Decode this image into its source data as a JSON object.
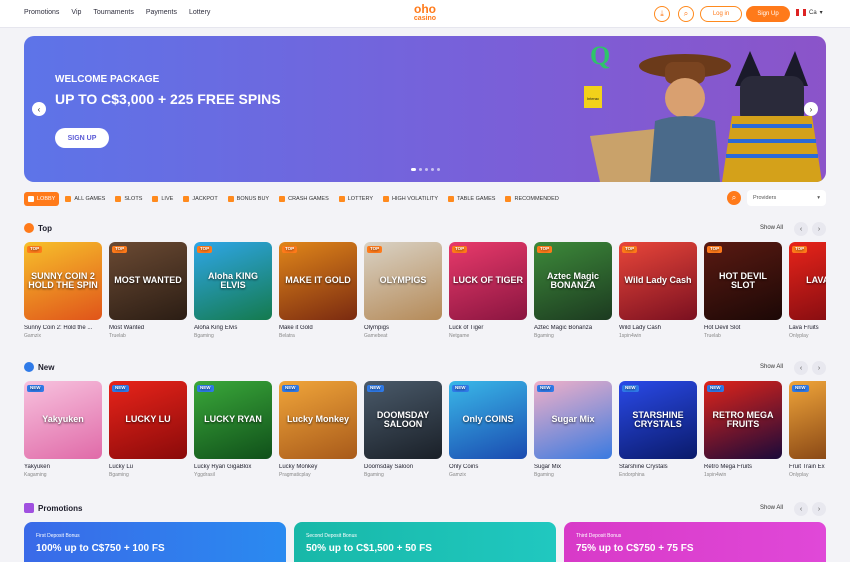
{
  "header": {
    "nav": [
      "Promotions",
      "Vip",
      "Tournaments",
      "Payments",
      "Lottery"
    ],
    "logo_top": "oho",
    "logo_bottom": "casino",
    "login_label": "Log in",
    "signup_label": "Sign Up",
    "lang_label": "Ca"
  },
  "hero": {
    "eyebrow": "WELCOME PACKAGE",
    "headline": "UP TO C$3,000 + 225 FREE SPINS",
    "cta": "SIGN UP",
    "prev": "‹",
    "next": "›",
    "payment_badge": "Interac"
  },
  "tabs": [
    "LOBBY",
    "ALL GAMES",
    "SLOTS",
    "LIVE",
    "JACKPOT",
    "BONUS BUY",
    "CRASH GAMES",
    "LOTTERY",
    "HIGH VOLATILITY",
    "TABLE GAMES",
    "RECOMMENDED"
  ],
  "providers_placeholder": "Providers",
  "colors": {
    "accent": "#ff7a1a",
    "hero_start": "#5d74e8",
    "hero_end": "#8b54c9"
  },
  "top": {
    "title": "Top",
    "show_all": "Show All",
    "badge": "TOP",
    "games": [
      {
        "name": "Sunny Coin 2: Hold the ...",
        "provider": "Gamzix",
        "art": "SUNNY COIN 2 HOLD THE SPIN",
        "bg": "linear-gradient(160deg,#f7c02b,#e0541a)"
      },
      {
        "name": "Most Wanted",
        "provider": "Truelab",
        "art": "MOST WANTED",
        "bg": "linear-gradient(160deg,#6b4a33,#2b1d14)"
      },
      {
        "name": "Aloha King Elvis",
        "provider": "Bgaming",
        "art": "Aloha KING ELVIS",
        "bg": "linear-gradient(160deg,#2fa6e8,#147a4d)"
      },
      {
        "name": "Make it Gold",
        "provider": "Belatra",
        "art": "MAKE IT GOLD",
        "bg": "linear-gradient(160deg,#e0861a,#7a2a10)"
      },
      {
        "name": "Olympigs",
        "provider": "Gamebeat",
        "art": "OLYMPIGS",
        "bg": "linear-gradient(160deg,#d9d2c5,#b58a58)"
      },
      {
        "name": "Luck of Tiger",
        "provider": "Netgame",
        "art": "LUCK OF TIGER",
        "bg": "linear-gradient(160deg,#e83a6b,#8a1540)"
      },
      {
        "name": "Aztec Magic Bonanza",
        "provider": "Bgaming",
        "art": "Aztec Magic BONANZA",
        "bg": "linear-gradient(160deg,#3d8a3a,#1c3a20)"
      },
      {
        "name": "Wild Lady Cash",
        "provider": "1spin4win",
        "art": "Wild Lady Cash",
        "bg": "linear-gradient(160deg,#e8463a,#7a1020)"
      },
      {
        "name": "Hot Devil Slot",
        "provider": "Truelab",
        "art": "HOT DEVIL SLOT",
        "bg": "linear-gradient(160deg,#5a1a12,#1c0806)"
      },
      {
        "name": "Lava Fruits",
        "provider": "Onlyplay",
        "art": "LAVA FRU",
        "bg": "linear-gradient(160deg,#e8241a,#7a0a10)"
      }
    ]
  },
  "new": {
    "title": "New",
    "show_all": "Show All",
    "badge": "NEW",
    "games": [
      {
        "name": "Yakyuken",
        "provider": "Kagaming",
        "art": "Yakyuken",
        "bg": "linear-gradient(160deg,#f7c2de,#e06aa8)"
      },
      {
        "name": "Lucky Lu",
        "provider": "Bgaming",
        "art": "LUCKY LU",
        "bg": "linear-gradient(160deg,#e8241a,#8a0a0a)"
      },
      {
        "name": "Lucky Ryan GigaBlox",
        "provider": "Yggdrasil",
        "art": "LUCKY RYAN",
        "bg": "linear-gradient(160deg,#3aa83a,#10501a)"
      },
      {
        "name": "Lucky Monkey",
        "provider": "Pragmaticplay",
        "art": "Lucky Monkey",
        "bg": "linear-gradient(160deg,#f0a53a,#a85a1a)"
      },
      {
        "name": "Doomsday Saloon",
        "provider": "Bgaming",
        "art": "DOOMSDAY SALOON",
        "bg": "linear-gradient(160deg,#4a5a6a,#1a2028)"
      },
      {
        "name": "Only Coins",
        "provider": "Gamzix",
        "art": "Only COINS",
        "bg": "linear-gradient(160deg,#3ab8e8,#1a4ab0)"
      },
      {
        "name": "Sugar Mix",
        "provider": "Bgaming",
        "art": "Sugar Mix",
        "bg": "linear-gradient(160deg,#f0b0c8,#3a7ae0)"
      },
      {
        "name": "Starshine Crystals",
        "provider": "Endorphina",
        "art": "STARSHINE CRYSTALS",
        "bg": "linear-gradient(160deg,#2a4ae8,#0a1a6a)"
      },
      {
        "name": "Retro Mega Fruits",
        "provider": "1spin4win",
        "art": "RETRO MEGA FRUITS",
        "bg": "linear-gradient(160deg,#e0241a,#1a0a3a)"
      },
      {
        "name": "Fruit Train Ex",
        "provider": "Onlyplay",
        "art": "",
        "bg": "linear-gradient(160deg,#f0a53a,#7a3a10)"
      }
    ]
  },
  "promotions": {
    "title": "Promotions",
    "show_all": "Show All",
    "cards": [
      {
        "label": "First Deposit Bonus",
        "title": "100% up to C$750 + 100 FS",
        "bg": "linear-gradient(90deg,#3a6ae8,#2a8af0)"
      },
      {
        "label": "Second Deposit Bonus",
        "title": "50% up to C$1,500 + 50 FS",
        "bg": "linear-gradient(90deg,#18b8a8,#20c8c0)"
      },
      {
        "label": "Third Deposit Bonus",
        "title": "75% up to C$750 + 75 FS",
        "bg": "linear-gradient(90deg,#d83ac8,#e048d8)"
      }
    ]
  }
}
